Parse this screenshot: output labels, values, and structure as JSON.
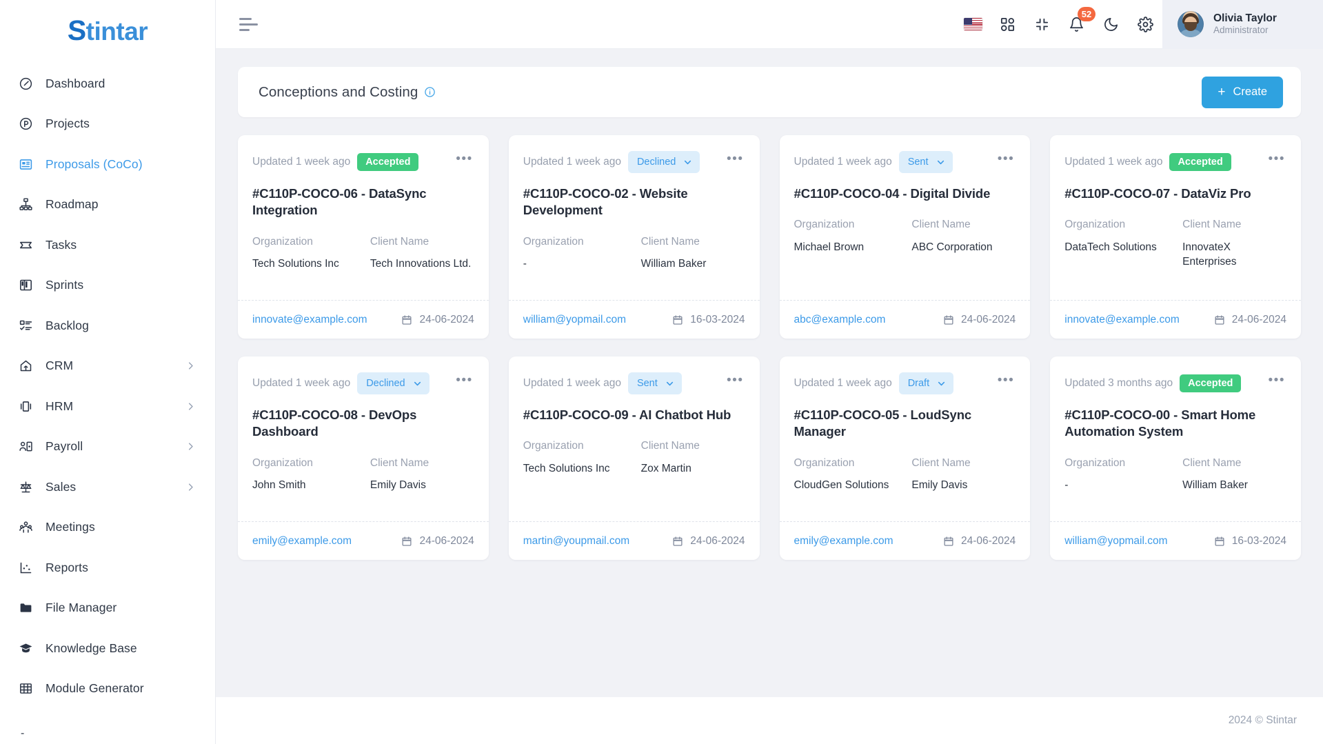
{
  "brand": {
    "prefix": "S",
    "rest": "tintar"
  },
  "sidebar": {
    "items": [
      {
        "label": "Dashboard",
        "icon": "gauge-icon",
        "active": false,
        "expandable": false
      },
      {
        "label": "Projects",
        "icon": "projects-icon",
        "active": false,
        "expandable": false
      },
      {
        "label": "Proposals (CoCo)",
        "icon": "proposals-icon",
        "active": true,
        "expandable": false
      },
      {
        "label": "Roadmap",
        "icon": "roadmap-icon",
        "active": false,
        "expandable": false
      },
      {
        "label": "Tasks",
        "icon": "tasks-icon",
        "active": false,
        "expandable": false
      },
      {
        "label": "Sprints",
        "icon": "sprints-icon",
        "active": false,
        "expandable": false
      },
      {
        "label": "Backlog",
        "icon": "backlog-icon",
        "active": false,
        "expandable": false
      },
      {
        "label": "CRM",
        "icon": "crm-icon",
        "active": false,
        "expandable": true
      },
      {
        "label": "HRM",
        "icon": "hrm-icon",
        "active": false,
        "expandable": true
      },
      {
        "label": "Payroll",
        "icon": "payroll-icon",
        "active": false,
        "expandable": true
      },
      {
        "label": "Sales",
        "icon": "sales-icon",
        "active": false,
        "expandable": true
      },
      {
        "label": "Meetings",
        "icon": "meetings-icon",
        "active": false,
        "expandable": false
      },
      {
        "label": "Reports",
        "icon": "reports-icon",
        "active": false,
        "expandable": false
      },
      {
        "label": "File Manager",
        "icon": "folder-icon",
        "active": false,
        "expandable": false
      },
      {
        "label": "Knowledge Base",
        "icon": "graduation-cap-icon",
        "active": false,
        "expandable": false
      },
      {
        "label": "Module Generator",
        "icon": "grid-table-icon",
        "active": false,
        "expandable": false
      }
    ],
    "trailing_marker": "-"
  },
  "topbar": {
    "menu_toggle": "hamburger-icon",
    "actions": [
      {
        "name": "language-flag",
        "label": "US"
      },
      {
        "name": "apps-grid-icon",
        "label": "Apps"
      },
      {
        "name": "fullscreen-exit-icon",
        "label": "Collapse"
      },
      {
        "name": "notifications-bell-icon",
        "label": "Notifications",
        "badge": "52"
      },
      {
        "name": "dark-mode-moon-icon",
        "label": "Dark mode"
      },
      {
        "name": "settings-gear-icon",
        "label": "Settings"
      }
    ],
    "profile": {
      "name": "Olivia Taylor",
      "role": "Administrator"
    }
  },
  "page": {
    "title": "Conceptions and Costing",
    "info_tooltip_icon": "info-circle-icon",
    "create_label": "Create",
    "create_plus": "+"
  },
  "labels": {
    "organization": "Organization",
    "client_name": "Client Name"
  },
  "cards": [
    {
      "updated": "Updated 1 week ago",
      "status": "Accepted",
      "status_type": "badge",
      "title": "#C110P-COCO-06 - DataSync Integration",
      "organization": "Tech Solutions Inc",
      "client_name": "Tech Innovations Ltd.",
      "email": "innovate@example.com",
      "date": "24-06-2024"
    },
    {
      "updated": "Updated 1 week ago",
      "status": "Declined",
      "status_type": "select",
      "title": "#C110P-COCO-02 - Website Development",
      "organization": "-",
      "client_name": "William Baker",
      "email": "william@yopmail.com",
      "date": "16-03-2024"
    },
    {
      "updated": "Updated 1 week ago",
      "status": "Sent",
      "status_type": "select",
      "title": "#C110P-COCO-04 - Digital Divide",
      "organization": "Michael Brown",
      "client_name": "ABC Corporation",
      "email": "abc@example.com",
      "date": "24-06-2024"
    },
    {
      "updated": "Updated 1 week ago",
      "status": "Accepted",
      "status_type": "badge",
      "title": "#C110P-COCO-07 - DataViz Pro",
      "organization": "DataTech Solutions",
      "client_name": "InnovateX Enterprises",
      "email": "innovate@example.com",
      "date": "24-06-2024"
    },
    {
      "updated": "Updated 1 week ago",
      "status": "Declined",
      "status_type": "select",
      "title": "#C110P-COCO-08 - DevOps Dashboard",
      "organization": "John Smith",
      "client_name": "Emily Davis",
      "email": "emily@example.com",
      "date": "24-06-2024"
    },
    {
      "updated": "Updated 1 week ago",
      "status": "Sent",
      "status_type": "select",
      "title": "#C110P-COCO-09 - AI Chatbot Hub",
      "organization": "Tech Solutions Inc",
      "client_name": "Zox Martin",
      "email": "martin@youpmail.com",
      "date": "24-06-2024"
    },
    {
      "updated": "Updated 1 week ago",
      "status": "Draft",
      "status_type": "select",
      "title": "#C110P-COCO-05 - LoudSync Manager",
      "organization": "CloudGen Solutions",
      "client_name": "Emily Davis",
      "email": "emily@example.com",
      "date": "24-06-2024"
    },
    {
      "updated": "Updated 3 months ago",
      "status": "Accepted",
      "status_type": "badge",
      "title": "#C110P-COCO-00 - Smart Home Automation System",
      "organization": "-",
      "client_name": "William Baker",
      "email": "william@yopmail.com",
      "date": "16-03-2024"
    }
  ],
  "footer": {
    "copyright": "2024 © Stintar"
  },
  "colors": {
    "accent": "#3c9ae8",
    "create_button": "#2fa2e0",
    "accepted_badge": "#40cb7f",
    "select_badge_bg": "#ddeefb",
    "notification_badge": "#f4683f",
    "page_bg": "#f1f2f6"
  }
}
